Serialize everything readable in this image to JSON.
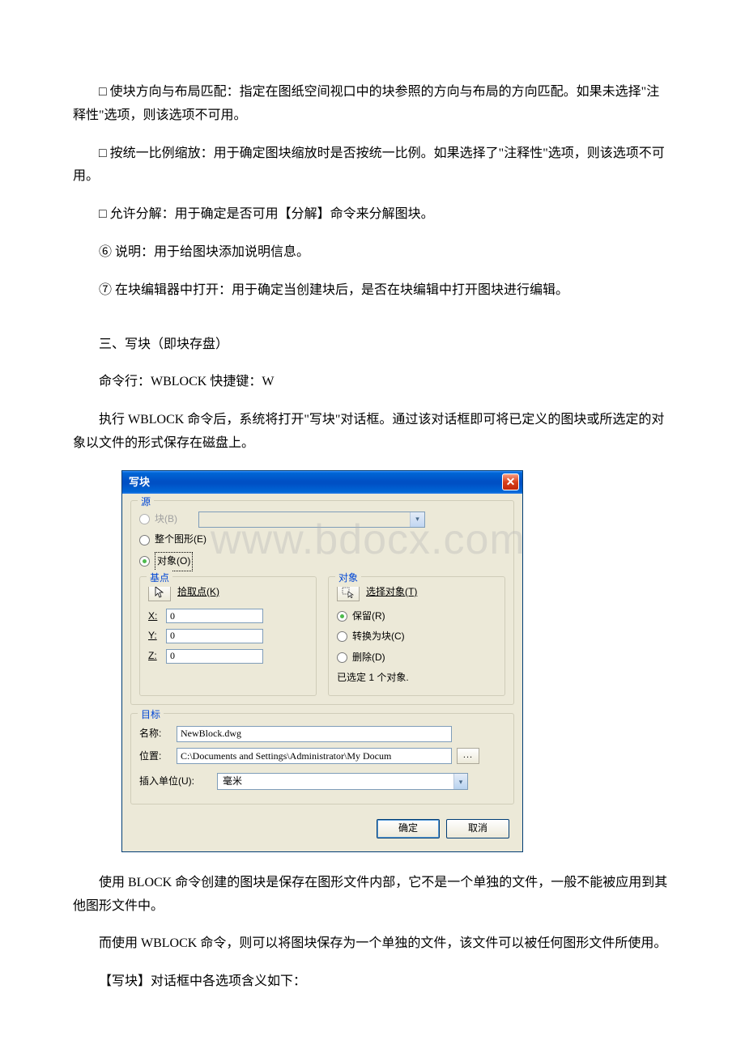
{
  "paras": {
    "p1": "□ 使块方向与布局匹配：指定在图纸空间视口中的块参照的方向与布局的方向匹配。如果未选择\"注释性\"选项，则该选项不可用。",
    "p2": "□ 按统一比例缩放：用于确定图块缩放时是否按统一比例。如果选择了\"注释性\"选项，则该选项不可用。",
    "p3": "□ 允许分解：用于确定是否可用【分解】命令来分解图块。",
    "p4": "⑥ 说明：用于给图块添加说明信息。",
    "p5": "⑦ 在块编辑器中打开：用于确定当创建块后，是否在块编辑中打开图块进行编辑。",
    "p6": "三、写块（即块存盘）",
    "p7": "命令行：WBLOCK  快捷键：W",
    "p8": "执行 WBLOCK 命令后，系统将打开\"写块\"对话框。通过该对话框即可将已定义的图块或所选定的对象以文件的形式保存在磁盘上。",
    "p9": "使用 BLOCK 命令创建的图块是保存在图形文件内部，它不是一个单独的文件，一般不能被应用到其他图形文件中。",
    "p10": "而使用 WBLOCK 命令，则可以将图块保存为一个单独的文件，该文件可以被任何图形文件所使用。",
    "p11": "【写块】对话框中各选项含义如下："
  },
  "watermark": "www.bdocx.com",
  "dialog": {
    "title": "写块",
    "source_title": "源",
    "block_label": "块(B)",
    "whole_label": "整个图形(E)",
    "objects_label": "对象(O)",
    "base_title": "基点",
    "pick_point": "拾取点(K)",
    "x_label": "X:",
    "y_label": "Y:",
    "z_label": "Z:",
    "x_val": "0",
    "y_val": "0",
    "z_val": "0",
    "obj_title": "对象",
    "select_obj": "选择对象(T)",
    "retain": "保留(R)",
    "convert": "转换为块(C)",
    "delete": "删除(D)",
    "selected": "已选定 1 个对象.",
    "dest_title": "目标",
    "name_label": "名称:",
    "name_val": "NewBlock.dwg",
    "loc_label": "位置:",
    "loc_val": "C:\\Documents and Settings\\Administrator\\My Docum",
    "unit_label": "插入单位(U):",
    "unit_val": "毫米",
    "ok": "确定",
    "cancel": "取消",
    "browse": "..."
  }
}
